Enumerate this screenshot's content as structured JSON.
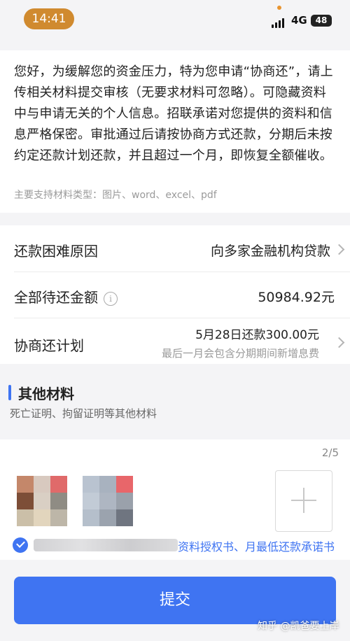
{
  "status": {
    "time": "14:41",
    "network": "4G",
    "battery": "48"
  },
  "notice": {
    "text": "您好，为缓解您的资金压力，特为您申请“协商还”，请上传相关材料提交审核（无要求材料可忽略）。可隐藏资料中与申请无关的个人信息。招联承诺对您提供的资料和信息严格保密。审批通过后请按协商方式还款，分期后未按约定还款计划还款，并且超过一个月，即恢复全额催收。",
    "supported_types": "主要支持材料类型：图片、word、excel、pdf"
  },
  "form": {
    "reason_label": "还款困难原因",
    "reason_value": "向多家金融机构贷款",
    "amount_label": "全部待还金额",
    "amount_value": "50984.92元",
    "plan_label": "协商还计划",
    "plan_main": "5月28日还款300.00元",
    "plan_sub": "最后一月会包含分期期间新增息费"
  },
  "materials": {
    "title": "其他材料",
    "desc": "死亡证明、拘留证明等其他材料",
    "count": "2/5"
  },
  "agreement": {
    "text": "资料授权书、月最低还款承诺书"
  },
  "submit_label": "提交",
  "watermark": "知乎 @凯爸要上岸",
  "colors": {
    "accent": "#3f74f2",
    "time_pill": "#d08a2f"
  }
}
